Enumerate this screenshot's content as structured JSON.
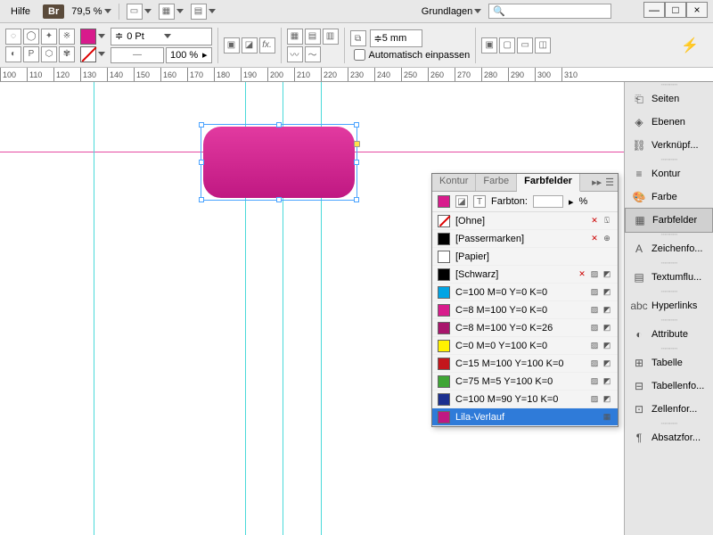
{
  "menubar": {
    "help": "Hilfe",
    "br": "Br",
    "zoom": "79,5 %",
    "workspace": "Grundlagen",
    "search_placeholder": ""
  },
  "win": {
    "min": "—",
    "max": "□",
    "close": "×"
  },
  "toolbar": {
    "stroke_weight": "0 Pt",
    "opacity": "100 %",
    "inset": "5 mm",
    "autofit_label": "Automatisch einpassen"
  },
  "ruler": {
    "start": 100,
    "step": 10,
    "count": 22
  },
  "guides": {
    "v": [
      105,
      275,
      317,
      360
    ]
  },
  "shape": {
    "color_top": "#e23aa0",
    "color_bottom": "#c01882"
  },
  "panel": {
    "tabs": [
      "Kontur",
      "Farbe",
      "Farbfelder"
    ],
    "active_tab": 2,
    "tint_label": "Farbton:",
    "tint_unit": "%",
    "swatches": [
      {
        "name": "[Ohne]",
        "color": "none",
        "locked": true,
        "noedit": true
      },
      {
        "name": "[Passermarken]",
        "color": "#000000",
        "locked": true,
        "reg": true
      },
      {
        "name": "[Papier]",
        "color": "#ffffff"
      },
      {
        "name": "[Schwarz]",
        "color": "#000000",
        "locked": true,
        "cmyk": true
      },
      {
        "name": "C=100 M=0 Y=0 K=0",
        "color": "#00a4e4",
        "cmyk": true
      },
      {
        "name": "C=8 M=100 Y=0 K=0",
        "color": "#d81b8c",
        "cmyk": true
      },
      {
        "name": "C=8 M=100 Y=0 K=26",
        "color": "#a8156c",
        "cmyk": true
      },
      {
        "name": "C=0 M=0 Y=100 K=0",
        "color": "#fff200",
        "cmyk": true
      },
      {
        "name": "C=15 M=100 Y=100 K=0",
        "color": "#c4161c",
        "cmyk": true
      },
      {
        "name": "C=75 M=5 Y=100 K=0",
        "color": "#3fa535",
        "cmyk": true
      },
      {
        "name": "C=100 M=90 Y=10 K=0",
        "color": "#1b2f8f",
        "cmyk": true
      },
      {
        "name": "Lila-Verlauf",
        "color": "#c01882",
        "gradient": true,
        "selected": true
      }
    ]
  },
  "dock": {
    "groups": [
      [
        {
          "icon": "⎗",
          "label": "Seiten"
        },
        {
          "icon": "◈",
          "label": "Ebenen"
        },
        {
          "icon": "⛓",
          "label": "Verknüpf..."
        }
      ],
      [
        {
          "icon": "≡",
          "label": "Kontur"
        },
        {
          "icon": "🎨",
          "label": "Farbe"
        },
        {
          "icon": "▦",
          "label": "Farbfelder",
          "selected": true
        }
      ],
      [
        {
          "icon": "A",
          "label": "Zeichenfo..."
        }
      ],
      [
        {
          "icon": "▤",
          "label": "Textumflu..."
        }
      ],
      [
        {
          "icon": "abc",
          "label": "Hyperlinks"
        }
      ],
      [
        {
          "icon": "◐",
          "label": "Attribute"
        }
      ],
      [
        {
          "icon": "⊞",
          "label": "Tabelle"
        },
        {
          "icon": "⊟",
          "label": "Tabellenfo..."
        },
        {
          "icon": "⊡",
          "label": "Zellenfor..."
        }
      ],
      [
        {
          "icon": "¶",
          "label": "Absatzfor..."
        }
      ]
    ]
  }
}
